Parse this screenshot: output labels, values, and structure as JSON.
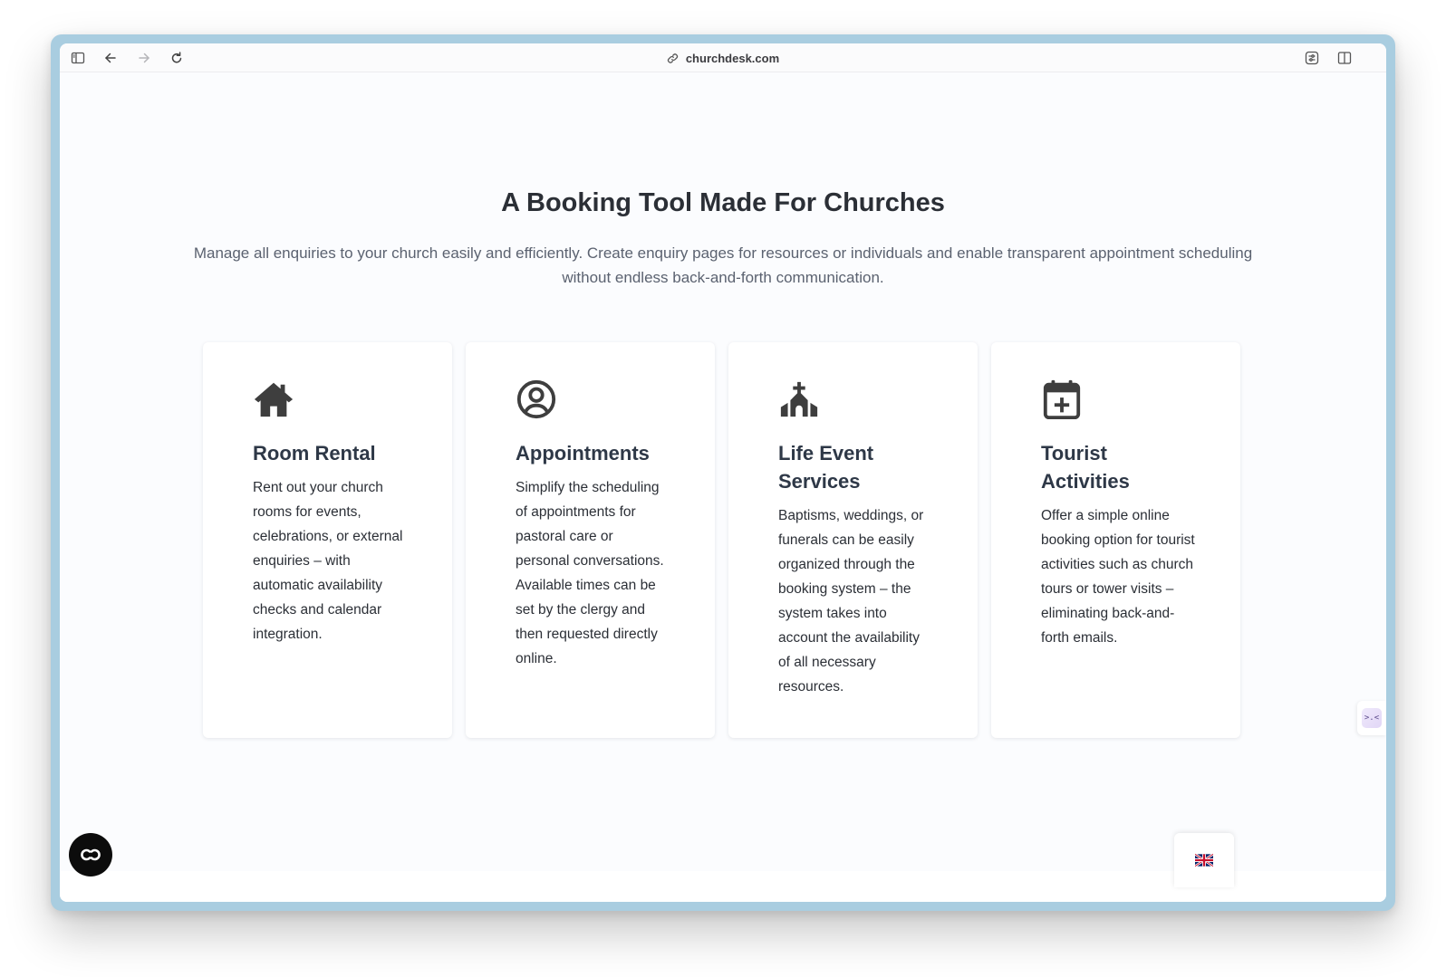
{
  "browser": {
    "url": "churchdesk.com",
    "icons": {
      "sidebar": "sidebar-icon",
      "back": "back-arrow-icon",
      "forward": "forward-arrow-icon",
      "reload": "reload-icon",
      "link": "link-icon",
      "extension": "extension-icon",
      "split_view": "split-view-icon"
    }
  },
  "page": {
    "headline": "A Booking Tool Made For Churches",
    "subtitle": "Manage all enquiries to your church easily and efficiently. Create enquiry pages for resources or individuals and enable transparent appointment scheduling without endless back-and-forth communication.",
    "cards": [
      {
        "icon": "house-icon",
        "title": "Room Rental",
        "text": "Rent out your church rooms for events, celebrations, or external enquiries – with automatic availability checks and calendar integration."
      },
      {
        "icon": "user-circle-icon",
        "title": "Appointments",
        "text": "Simplify the scheduling of appointments for pastoral care or personal conversations. Available times can be set by the clergy and then requested directly online."
      },
      {
        "icon": "church-icon",
        "title": "Life Event Services",
        "text": "Baptisms, weddings, or funerals can be easily organized through the booking system – the system takes into account the availability of all necessary resources."
      },
      {
        "icon": "calendar-plus-icon",
        "title": "Tourist Activities",
        "text": "Offer a simple online booking option for tourist activities such as church tours or tower visits – eliminating back-and-forth emails."
      }
    ]
  },
  "widgets": {
    "side_tab": ">.<",
    "cookie_icon": "cookie-consent-icon",
    "language_icon": "uk-flag-icon"
  },
  "colors": {
    "frame": "#a9cde0",
    "heading": "#2b2f36",
    "card_title": "#2e3847",
    "icon": "#3e3e3e"
  }
}
